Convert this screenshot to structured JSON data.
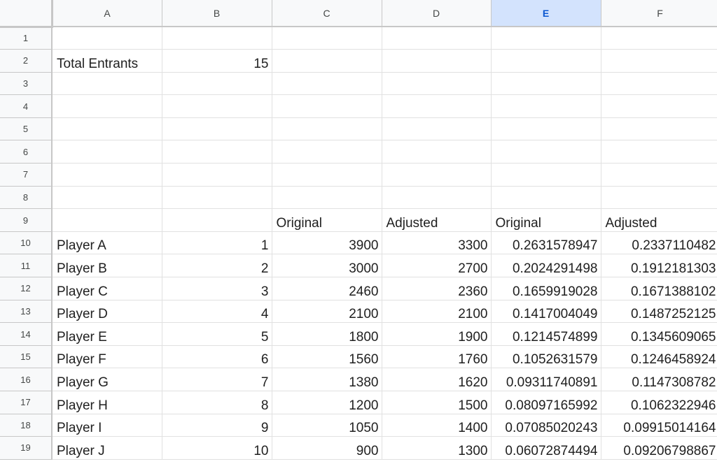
{
  "columns": [
    "A",
    "B",
    "C",
    "D",
    "E",
    "F"
  ],
  "selected_column": "E",
  "row_numbers": [
    "1",
    "2",
    "3",
    "4",
    "5",
    "6",
    "7",
    "8",
    "9",
    "10",
    "11",
    "12",
    "13",
    "14",
    "15",
    "16",
    "17",
    "18",
    "19"
  ],
  "summary": {
    "label": "Total Entrants",
    "value": "15"
  },
  "headers": {
    "c": "Original",
    "d": "Adjusted",
    "e": "Original",
    "f": "Adjusted"
  },
  "players": [
    {
      "name": "Player A",
      "rank": "1",
      "original": "3900",
      "adjusted": "3300",
      "original_pct": "0.2631578947",
      "adjusted_pct": "0.2337110482"
    },
    {
      "name": "Player B",
      "rank": "2",
      "original": "3000",
      "adjusted": "2700",
      "original_pct": "0.2024291498",
      "adjusted_pct": "0.1912181303"
    },
    {
      "name": "Player C",
      "rank": "3",
      "original": "2460",
      "adjusted": "2360",
      "original_pct": "0.1659919028",
      "adjusted_pct": "0.1671388102"
    },
    {
      "name": "Player D",
      "rank": "4",
      "original": "2100",
      "adjusted": "2100",
      "original_pct": "0.1417004049",
      "adjusted_pct": "0.1487252125"
    },
    {
      "name": "Player E",
      "rank": "5",
      "original": "1800",
      "adjusted": "1900",
      "original_pct": "0.1214574899",
      "adjusted_pct": "0.1345609065"
    },
    {
      "name": "Player F",
      "rank": "6",
      "original": "1560",
      "adjusted": "1760",
      "original_pct": "0.1052631579",
      "adjusted_pct": "0.1246458924"
    },
    {
      "name": "Player G",
      "rank": "7",
      "original": "1380",
      "adjusted": "1620",
      "original_pct": "0.09311740891",
      "adjusted_pct": "0.1147308782"
    },
    {
      "name": "Player H",
      "rank": "8",
      "original": "1200",
      "adjusted": "1500",
      "original_pct": "0.08097165992",
      "adjusted_pct": "0.1062322946"
    },
    {
      "name": "Player I",
      "rank": "9",
      "original": "1050",
      "adjusted": "1400",
      "original_pct": "0.07085020243",
      "adjusted_pct": "0.09915014164"
    },
    {
      "name": "Player J",
      "rank": "10",
      "original": "900",
      "adjusted": "1300",
      "original_pct": "0.06072874494",
      "adjusted_pct": "0.09206798867"
    }
  ]
}
